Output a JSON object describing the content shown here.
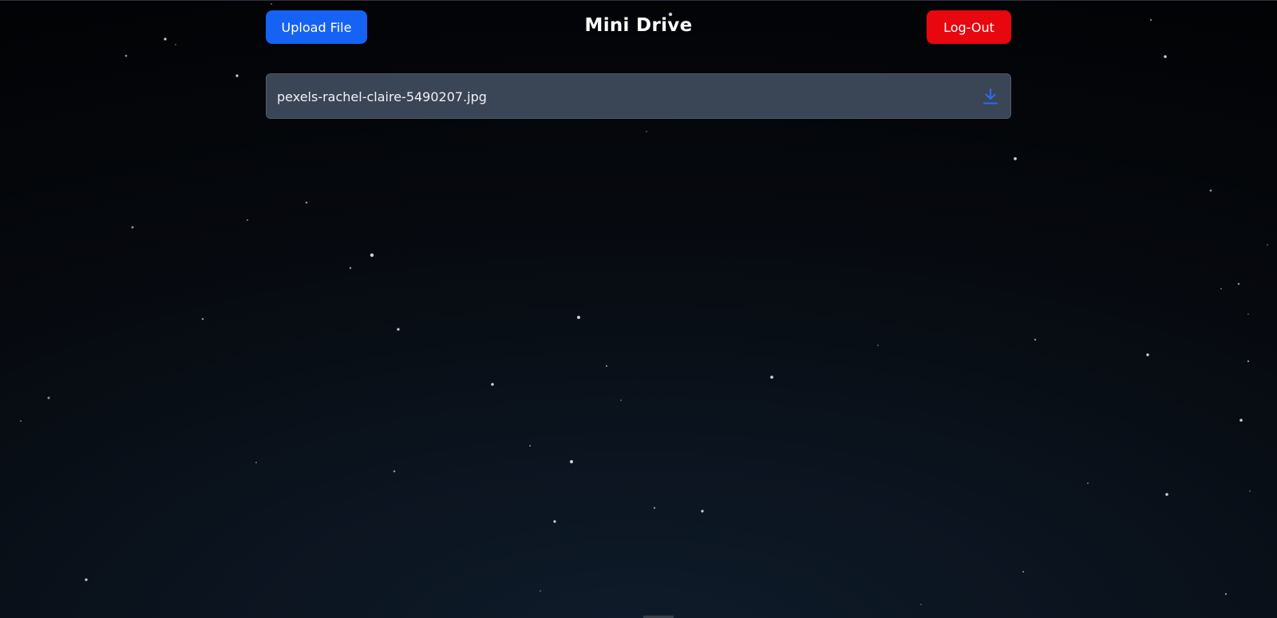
{
  "header": {
    "upload_label": "Upload File",
    "title": "Mini Drive",
    "logout_label": "Log-Out"
  },
  "files": [
    {
      "name": "pexels-rachel-claire-5490207.jpg",
      "action_icon": "download-icon"
    }
  ],
  "colors": {
    "upload_button": "#1662f5",
    "logout_button": "#e8060f",
    "file_card": "#3a4556",
    "download_icon": "#2b6cf3",
    "background_dark": "#020305",
    "background_glow": "#0f1c2b"
  }
}
